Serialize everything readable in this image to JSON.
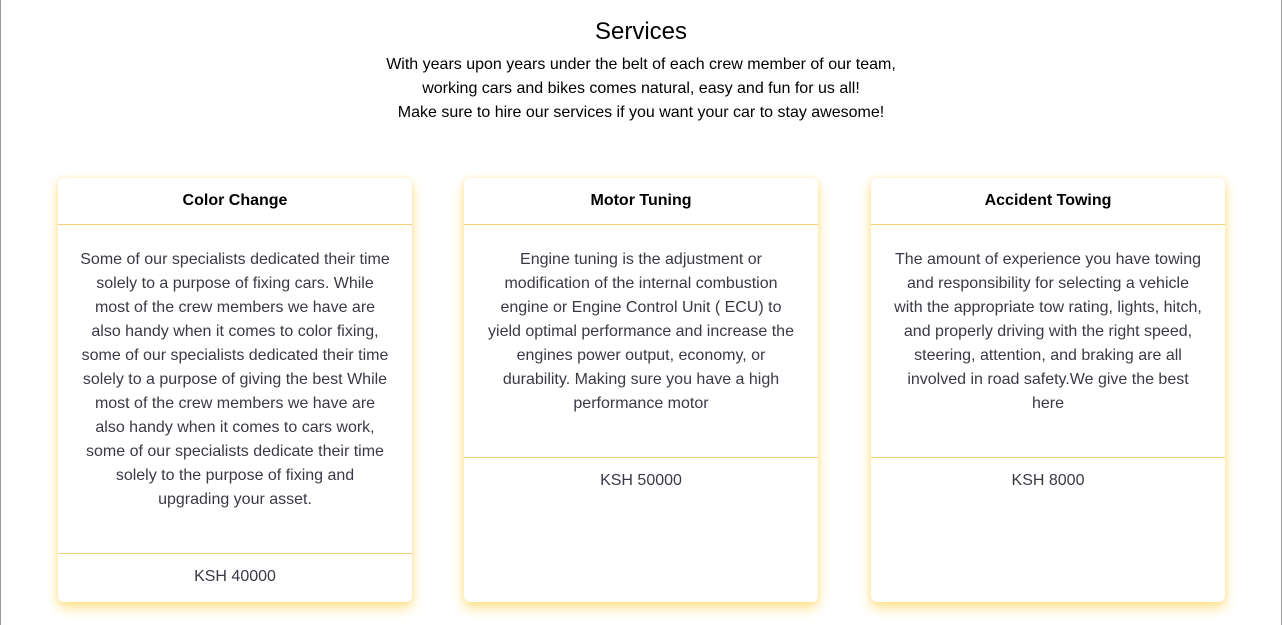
{
  "section": {
    "title": "Services",
    "intro": [
      "With years upon years under the belt of each crew member of our team,",
      "working cars and bikes comes natural, easy and fun for us all!",
      "Make sure to hire our services if you want your car to stay awesome!"
    ]
  },
  "services": [
    {
      "title": "Color Change",
      "description": "Some of our specialists dedicated their time solely to a purpose of fixing cars. While most of the crew members we have are also handy when it comes to color fixing, some of our specialists dedicated their time solely to a purpose of giving the best While most of the crew members we have are also handy when it comes to cars work, some of our specialists dedicate their time solely to the purpose of fixing and upgrading your asset.",
      "price": "KSH 40000"
    },
    {
      "title": "Motor Tuning",
      "description": "Engine tuning is the adjustment or modification of the internal combustion engine or Engine Control Unit ( ECU) to yield optimal performance and increase the engines power output, economy, or durability. Making sure you have a high performance motor",
      "price": "KSH 50000"
    },
    {
      "title": "Accident Towing",
      "description": "The amount of experience you have towing and responsibility for selecting a vehicle with the appropriate tow rating, lights, hitch, and properly driving with the right speed, steering, attention, and braking are all involved in road safety.We give the best here",
      "price": "KSH 8000"
    }
  ]
}
